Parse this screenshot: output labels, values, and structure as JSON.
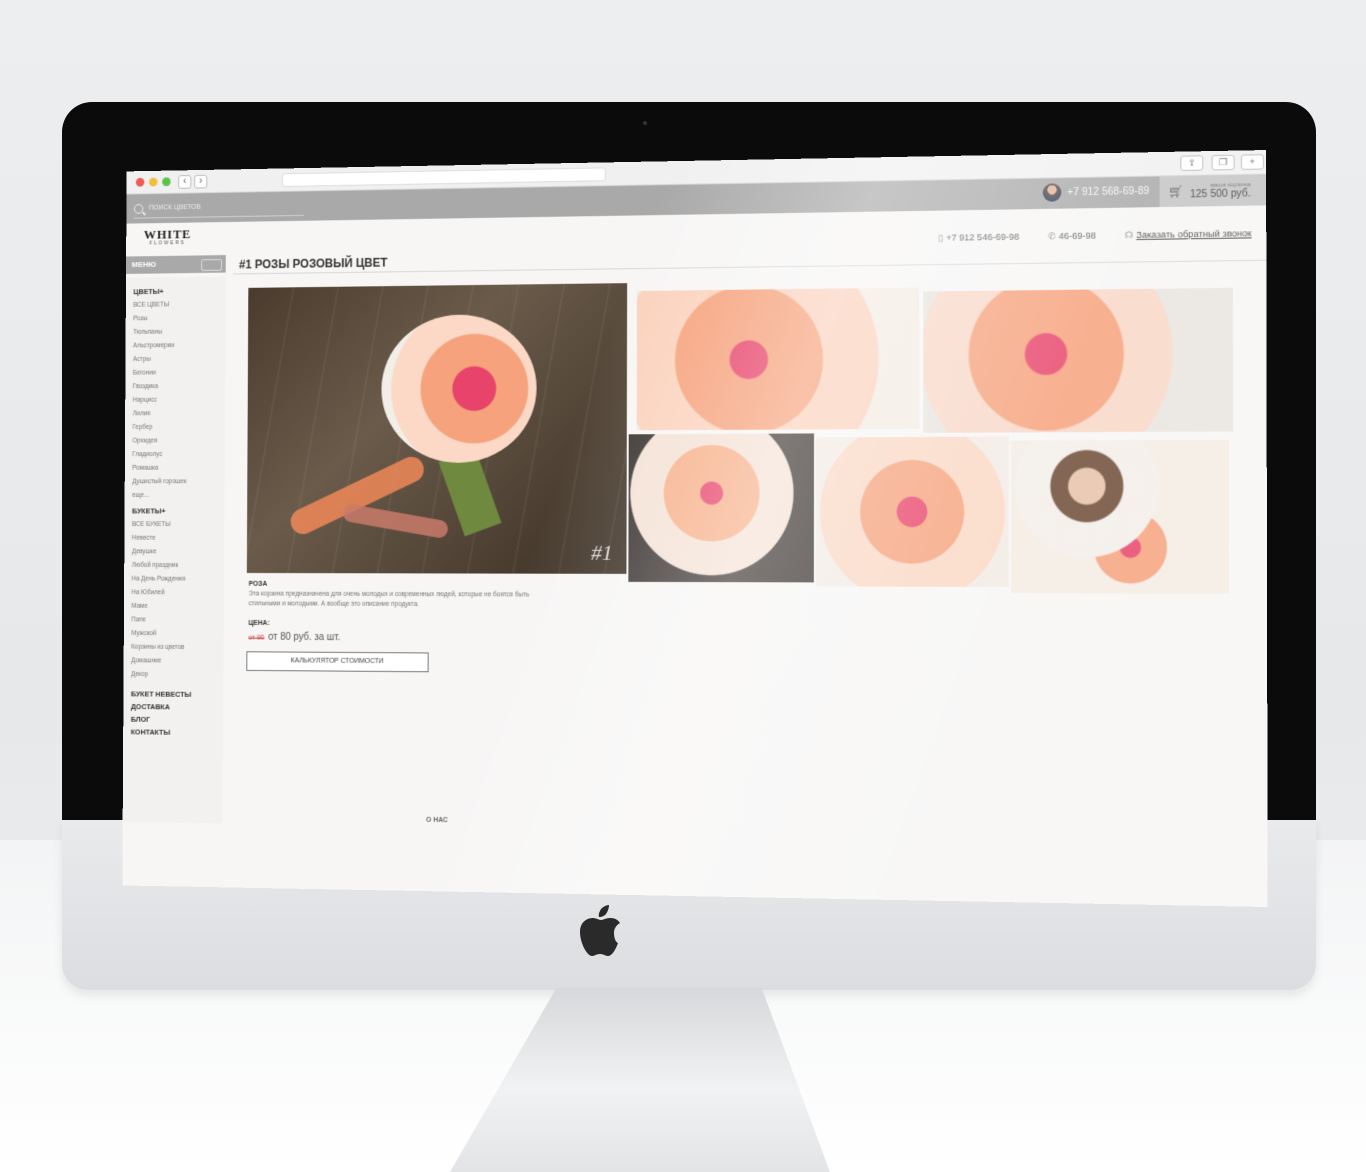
{
  "search": {
    "placeholder": "ПОИСК ЦВЕТОВ"
  },
  "topbar": {
    "user_phone": "+7 912 568-69-89"
  },
  "cart": {
    "label": "ваша корзина",
    "total": "125 500 руб."
  },
  "logo": {
    "name": "WHITE",
    "sub": "FLOWERS"
  },
  "contacts": {
    "mobile": "+7 912 546-69-98",
    "phone": "46-69-98",
    "callback": "Заказать обратный звонок"
  },
  "menu": {
    "title": "МЕНЮ",
    "flowers_title": "ЦВЕТЫ+",
    "flowers": [
      "ВСЕ ЦВЕТЫ",
      "Розы",
      "Тюльпаны",
      "Альстромерии",
      "Астры",
      "Бегонии",
      "Гвоздика",
      "Нарцисс",
      "Лилия",
      "Гербер",
      "Орхидея",
      "Гладиолус",
      "Ромашка",
      "Душистый горошек",
      "еще..."
    ],
    "bouquets_title": "БУКЕТЫ+",
    "bouquets": [
      "ВСЕ БУКЕТЫ",
      "Невесте",
      "Девушке",
      "Любой праздник",
      "На День Рождения",
      "На Юбилей",
      "Маме",
      "Папе",
      "Мужской",
      "Корзины из цветов",
      "Домашние",
      "Декор"
    ],
    "bottom": [
      "БУКЕТ НЕВЕСТЫ",
      "ДОСТАВКА",
      "БЛОГ",
      "КОНТАКТЫ"
    ]
  },
  "product": {
    "title": "#1 РОЗЫ РОЗОВЫЙ ЦВЕТ",
    "photo_number": "#1",
    "name": "РОЗА",
    "description": "Эта корзина предназначена для очень молодых и современных людей, которые не боятся быть стильными и молодыми. А вообще это описание продукта.",
    "price_label": "ЦЕНА:",
    "old_price": "от 90",
    "price": "от 80 руб. за шт.",
    "calc_button": "КАЛЬКУЛЯТОР СТОИМОСТИ"
  },
  "footer": {
    "about": "О НАС"
  },
  "colors": {
    "accent": "#a9a9a9",
    "peach": "#f6a27c",
    "coral": "#e8436a"
  }
}
